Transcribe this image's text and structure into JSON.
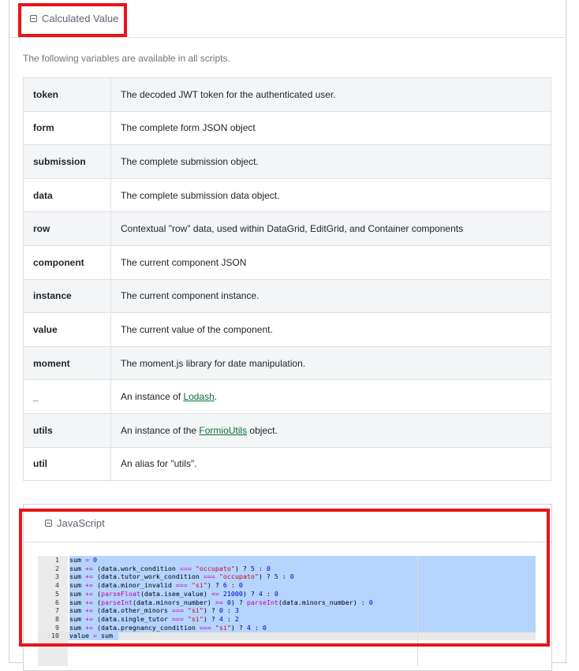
{
  "panel": {
    "title": "Calculated Value",
    "intro": "The following variables are available in all scripts."
  },
  "variables": [
    {
      "name": "token",
      "desc": "The decoded JWT token for the authenticated user."
    },
    {
      "name": "form",
      "desc": "The complete form JSON object"
    },
    {
      "name": "submission",
      "desc": "The complete submission object."
    },
    {
      "name": "data",
      "desc": "The complete submission data object."
    },
    {
      "name": "row",
      "desc": "Contextual \"row\" data, used within DataGrid, EditGrid, and Container components"
    },
    {
      "name": "component",
      "desc": "The current component JSON"
    },
    {
      "name": "instance",
      "desc": "The current component instance."
    },
    {
      "name": "value",
      "desc": "The current value of the component."
    },
    {
      "name": "moment",
      "desc": "The moment.js library for date manipulation."
    },
    {
      "name": "_",
      "desc_prefix": "An instance of ",
      "link": "Lodash",
      "desc_suffix": "."
    },
    {
      "name": "utils",
      "desc_prefix": "An instance of the ",
      "link": "FormioUtils",
      "desc_suffix": " object."
    },
    {
      "name": "util",
      "desc": "An alias for \"utils\"."
    }
  ],
  "js_panel": {
    "title": "JavaScript"
  },
  "editor": {
    "lines": [
      {
        "n": "1",
        "code": "sum = 0"
      },
      {
        "n": "2",
        "code": "sum += (data.work_condition === \"occupato\") ? 5 : 0"
      },
      {
        "n": "3",
        "code": "sum += (data.tutor_work_condition === \"occupato\") ? 5 : 0"
      },
      {
        "n": "4",
        "code": "sum += (data.minor_invalid === \"si\") ? 6 : 0"
      },
      {
        "n": "5",
        "code": "sum += (parseFloat(data.isee_value) <= 21000) ? 4 : 0"
      },
      {
        "n": "6",
        "code": "sum += (parseInt(data.minors_number) >= 0) ? parseInt(data.minors_number) : 0"
      },
      {
        "n": "7",
        "code": "sum += (data.other_minors === \"si\") ? 0 : 3"
      },
      {
        "n": "8",
        "code": "sum += (data.single_tutor === \"si\") ? 4 : 2"
      },
      {
        "n": "9",
        "code": "sum += (data.pregnancy_condition === \"si\") ? 4 : 0"
      },
      {
        "n": "10",
        "code": "value = sum"
      }
    ]
  },
  "colors": {
    "highlight": "#e8131b",
    "selection": "#b5d5ff",
    "link": "#0e6e3a"
  }
}
